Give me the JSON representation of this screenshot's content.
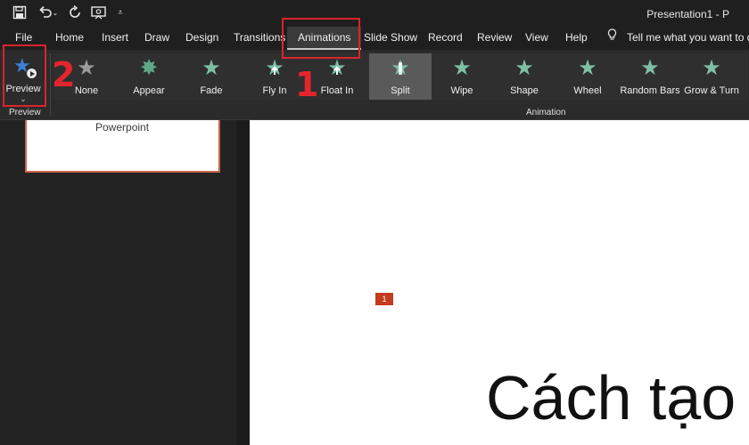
{
  "titlebar": {
    "doc_title": "Presentation1 - P",
    "quick_access": [
      "save-icon",
      "undo-icon",
      "redo-icon",
      "present-from-beginning-icon",
      "customize-toolbar-icon"
    ]
  },
  "menu": {
    "tabs": [
      "File",
      "Home",
      "Insert",
      "Draw",
      "Design",
      "Transitions",
      "Animations",
      "Slide Show",
      "Record",
      "Review",
      "View",
      "Help"
    ],
    "active": "Animations",
    "tell_me": "Tell me what you want to do"
  },
  "ribbon": {
    "preview": {
      "label": "Preview",
      "group": "Preview"
    },
    "animation_group_label": "Animation",
    "effects": [
      {
        "label": "None",
        "icon": "star-icon",
        "color": "#9a9a9a"
      },
      {
        "label": "Appear",
        "icon": "starburst-icon",
        "color": "#5fa88a"
      },
      {
        "label": "Fade",
        "icon": "star-icon",
        "color": "#7fbfa6"
      },
      {
        "label": "Fly In",
        "icon": "star-arrow-icon",
        "color": "#7fbfa6"
      },
      {
        "label": "Float In",
        "icon": "star-arrow-icon",
        "color": "#7fbfa6"
      },
      {
        "label": "Split",
        "icon": "star-split-icon",
        "color": "#7fbfa6",
        "selected": true
      },
      {
        "label": "Wipe",
        "icon": "star-icon",
        "color": "#7fbfa6"
      },
      {
        "label": "Shape",
        "icon": "star-icon",
        "color": "#7fbfa6"
      },
      {
        "label": "Wheel",
        "icon": "star-icon",
        "color": "#7fbfa6"
      },
      {
        "label": "Random Bars",
        "icon": "star-icon",
        "color": "#7fbfa6"
      },
      {
        "label": "Grow & Turn",
        "icon": "star-icon",
        "color": "#7fbfa6"
      }
    ]
  },
  "annotations": {
    "step1": "1",
    "step2": "2",
    "color": "#d8252b"
  },
  "thumbnail": {
    "text": "Powerpoint"
  },
  "slide": {
    "animation_tag": "1",
    "title_fragment": "Cách tạo"
  },
  "colors": {
    "accent": "#c43b1d",
    "preview_star": "#3d7fd8"
  }
}
